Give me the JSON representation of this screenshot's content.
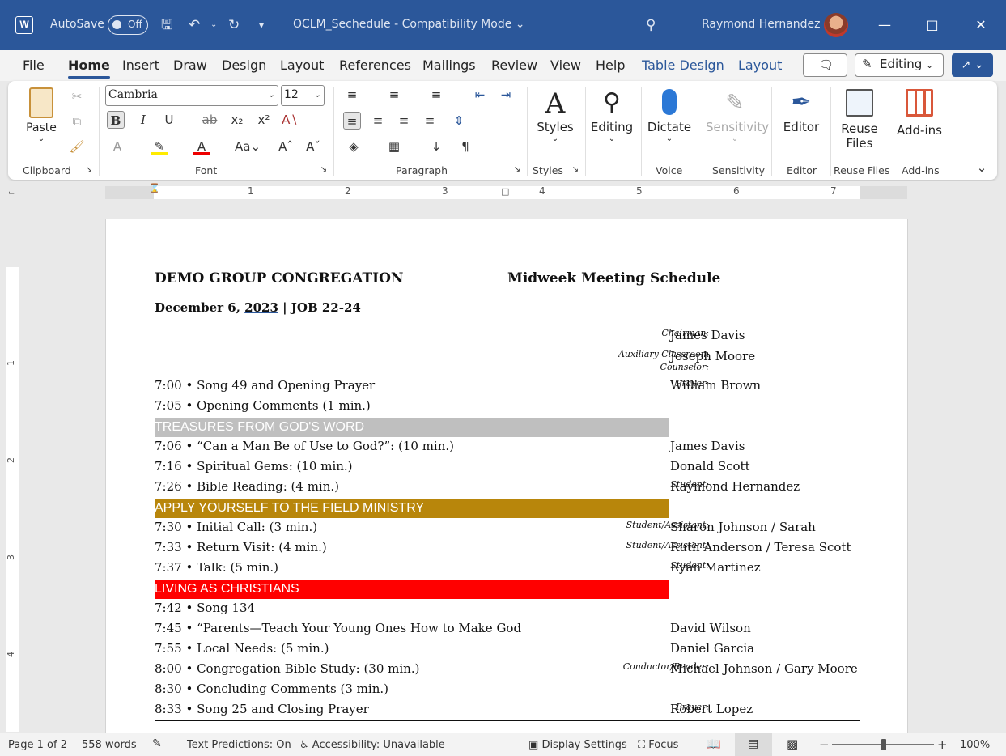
{
  "titlebar": {
    "app_icon": "W",
    "autosave_label": "AutoSave",
    "autosave_state": "Off",
    "document_title": "OCLM_Sechedule  -  Compatibility Mode",
    "user_name": "Raymond Hernandez"
  },
  "tabs": [
    "File",
    "Home",
    "Insert",
    "Draw",
    "Design",
    "Layout",
    "References",
    "Mailings",
    "Review",
    "View",
    "Help",
    "Table Design",
    "Layout"
  ],
  "active_tab": "Home",
  "top_right": {
    "editing_label": "Editing"
  },
  "ribbon": {
    "clipboard": {
      "paste_label": "Paste",
      "group_label": "Clipboard"
    },
    "font": {
      "name": "Cambria",
      "size": "12",
      "group_label": "Font"
    },
    "paragraph": {
      "group_label": "Paragraph"
    },
    "styles": {
      "label": "Styles",
      "group_label": "Styles"
    },
    "editing": {
      "label": "Editing"
    },
    "voice": {
      "label": "Dictate",
      "group_label": "Voice"
    },
    "sensitivity": {
      "label": "Sensitivity",
      "group_label": "Sensitivity"
    },
    "editor": {
      "label": "Editor",
      "group_label": "Editor"
    },
    "reuse": {
      "label_line1": "Reuse",
      "label_line2": "Files",
      "group_label": "Reuse Files"
    },
    "addins": {
      "label": "Add-ins",
      "group_label": "Add-ins"
    }
  },
  "ruler": {
    "numbers": [
      "1",
      "2",
      "3",
      "4",
      "5",
      "6",
      "7"
    ],
    "vertical_numbers": [
      "1",
      "2",
      "3",
      "4"
    ]
  },
  "document": {
    "congregation": "DEMO GROUP CONGREGATION",
    "schedule_title": "Midweek Meeting Schedule",
    "date_prefix": "December 6, ",
    "date_year": "2023",
    "date_suffix": " | JOB 22-24",
    "rows": [
      {
        "text": "",
        "label": "Chairman:",
        "name": "James Davis"
      },
      {
        "text": "",
        "label": "Auxiliary Classroom Counselor:",
        "name": "Joseph Moore"
      },
      {
        "text": "7:00 • Song 49 and Opening Prayer",
        "label": "Prayer:",
        "name": "William Brown"
      },
      {
        "text": "7:05 • Opening Comments (1 min.)",
        "label": "",
        "name": ""
      },
      {
        "text": "7:06 • “Can a Man Be of Use to God?”: (10 min.)",
        "label": "",
        "name": "James Davis"
      },
      {
        "text": "7:16 • Spiritual Gems: (10 min.)",
        "label": "",
        "name": "Donald Scott"
      },
      {
        "text": "7:26 • Bible Reading: (4 min.)",
        "label": "Student:",
        "name": "Raymond Hernandez"
      },
      {
        "text": "7:30 • Initial Call: (3 min.)",
        "label": "Student/Assistant:",
        "name": "Sharon Johnson / Sarah"
      },
      {
        "text": "7:33 • Return Visit: (4 min.)",
        "label": "Student/Assistant:",
        "name": "Ruth Anderson / Teresa Scott"
      },
      {
        "text": "7:37 • Talk: (5 min.)",
        "label": "Student:",
        "name": "Ryan Martinez"
      },
      {
        "text": "7:42 • Song 134",
        "label": "",
        "name": ""
      },
      {
        "text": "7:45 • “Parents—Teach Your Young Ones How to Make God",
        "label": "",
        "name": "David Wilson"
      },
      {
        "text": "7:55 • Local Needs: (5 min.)",
        "label": "",
        "name": "Daniel Garcia"
      },
      {
        "text": "8:00 • Congregation Bible Study: (30 min.)",
        "label": "Conductor/Reader:",
        "name": "Michael Johnson / Gary Moore"
      },
      {
        "text": "8:30 • Concluding Comments (3 min.)",
        "label": "",
        "name": ""
      },
      {
        "text": "8:33 • Song 25 and Closing Prayer",
        "label": "Prayer:",
        "name": "Robert Lopez"
      }
    ],
    "sections": [
      {
        "title": "TREASURES FROM GOD'S WORD",
        "color": "#bfbfbf"
      },
      {
        "title": "APPLY YOURSELF TO THE FIELD MINISTRY",
        "color": "#b8860b"
      },
      {
        "title": "LIVING AS CHRISTIANS",
        "color": "#ff0000"
      }
    ]
  },
  "status": {
    "page": "Page 1 of 2",
    "words": "558 words",
    "predictions": "Text Predictions: On",
    "accessibility": "Accessibility: Unavailable",
    "display": "Display Settings",
    "focus": "Focus",
    "zoom": "100%"
  },
  "colors": {
    "accent": "#2b579a",
    "ribbon_bg": "#f3f3f3"
  }
}
